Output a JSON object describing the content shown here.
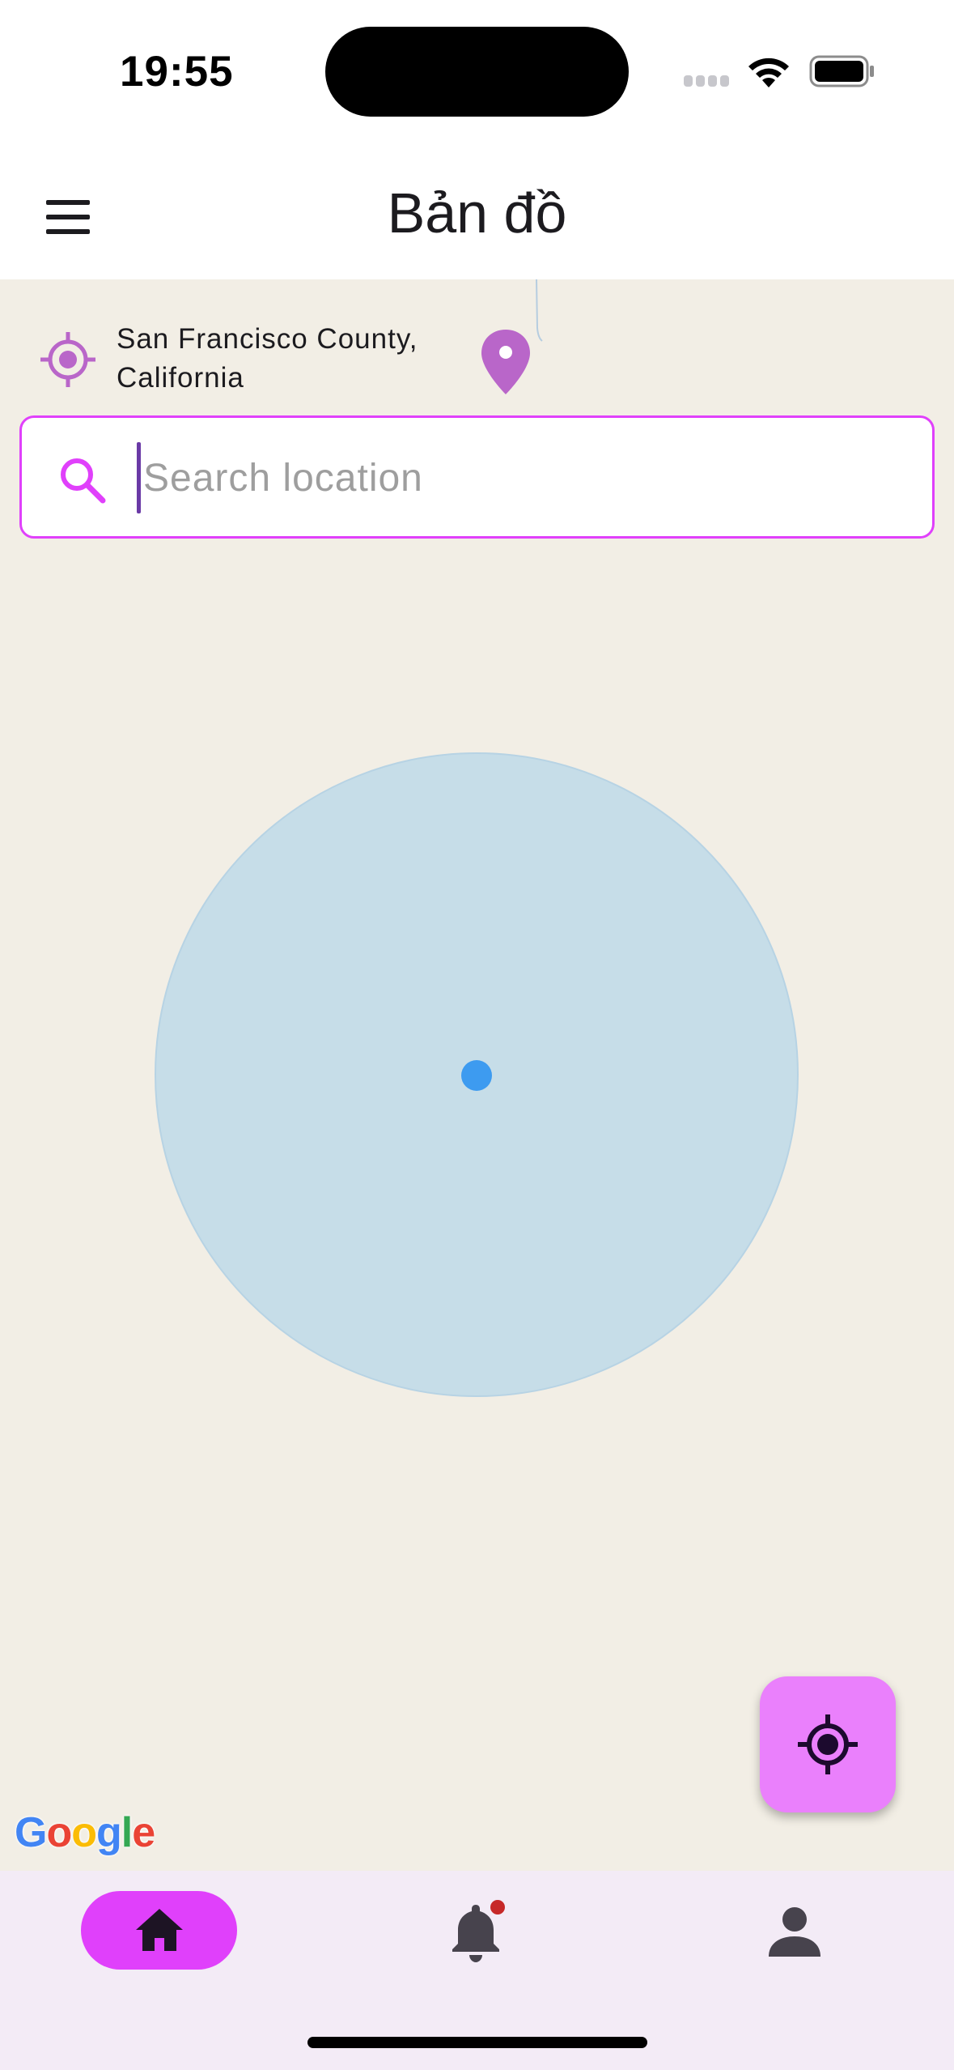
{
  "status_bar": {
    "time": "19:55",
    "icons": [
      "cellular-signal-icon",
      "wifi-icon",
      "battery-icon"
    ]
  },
  "app_bar": {
    "title": "Bản đồ",
    "menu_icon": "hamburger-menu-icon"
  },
  "location": {
    "current_text_line1": "San Francisco County,",
    "current_text_line2": "California",
    "target_icon": "location-target-icon",
    "pin_icon": "map-pin-icon"
  },
  "search": {
    "placeholder": "Search location",
    "value": "",
    "icon": "search-icon"
  },
  "map": {
    "attribution": [
      "G",
      "o",
      "o",
      "g",
      "l",
      "e"
    ],
    "fab_icon": "my-location-icon"
  },
  "bottom_nav": {
    "items": [
      {
        "name": "home",
        "icon": "home-icon",
        "active": true
      },
      {
        "name": "notifications",
        "icon": "bell-icon",
        "badge": true
      },
      {
        "name": "profile",
        "icon": "person-icon"
      }
    ]
  },
  "colors": {
    "accent": "#e040fb",
    "fab": "#ea80fc",
    "map_background": "#f2eee5",
    "accuracy_circle": "#c6dde8",
    "user_dot": "#3d9bf0",
    "nav_background": "#f3ebf6",
    "badge": "#c62828",
    "icon_purple": "#b966c9"
  }
}
